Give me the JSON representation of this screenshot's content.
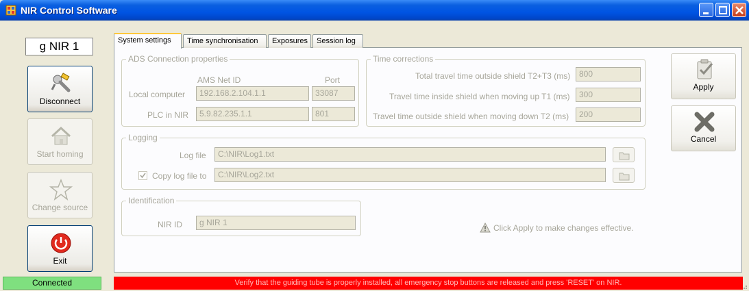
{
  "window": {
    "title": "NIR Control Software"
  },
  "left": {
    "nir_name": "g NIR 1",
    "disconnect_label": "Disconnect",
    "start_homing_label": "Start homing",
    "change_source_label": "Change source",
    "exit_label": "Exit"
  },
  "tabs": [
    {
      "label": "System settings",
      "active": true
    },
    {
      "label": "Time synchronisation",
      "active": false
    },
    {
      "label": "Exposures",
      "active": false
    },
    {
      "label": "Session log",
      "active": false
    }
  ],
  "ads": {
    "title": "ADS Connection properties",
    "col_netid": "AMS Net ID",
    "col_port": "Port",
    "local_label": "Local computer",
    "local_netid": "192.168.2.104.1.1",
    "local_port": "33087",
    "plc_label": "PLC in NIR",
    "plc_netid": "5.9.82.235.1.1",
    "plc_port": "801"
  },
  "time": {
    "title": "Time corrections",
    "total_label": "Total travel time outside shield T2+T3 (ms)",
    "total_value": "800",
    "inside_label": "Travel time inside shield when moving up T1 (ms)",
    "inside_value": "300",
    "outside_label": "Travel time outside shield when moving down T2 (ms)",
    "outside_value": "200"
  },
  "logging": {
    "title": "Logging",
    "logfile_label": "Log file",
    "logfile_value": "C:\\NIR\\Log1.txt",
    "copy_label": "Copy log file to",
    "copy_checked": true,
    "copy_value": "C:\\NIR\\Log2.txt"
  },
  "identification": {
    "title": "Identification",
    "nir_id_label": "NIR ID",
    "nir_id_value": "g NIR 1"
  },
  "actions": {
    "apply_label": "Apply",
    "cancel_label": "Cancel"
  },
  "notice": "Click Apply to make changes effective.",
  "status": {
    "connection": "Connected",
    "message": "Verify that the guiding tube is properly installed, all emergency stop buttons are released and press 'RESET' on NIR."
  },
  "colors": {
    "title_bar": "#0054e3",
    "status_ok": "#7fe07f",
    "status_alert": "#ff0000"
  }
}
